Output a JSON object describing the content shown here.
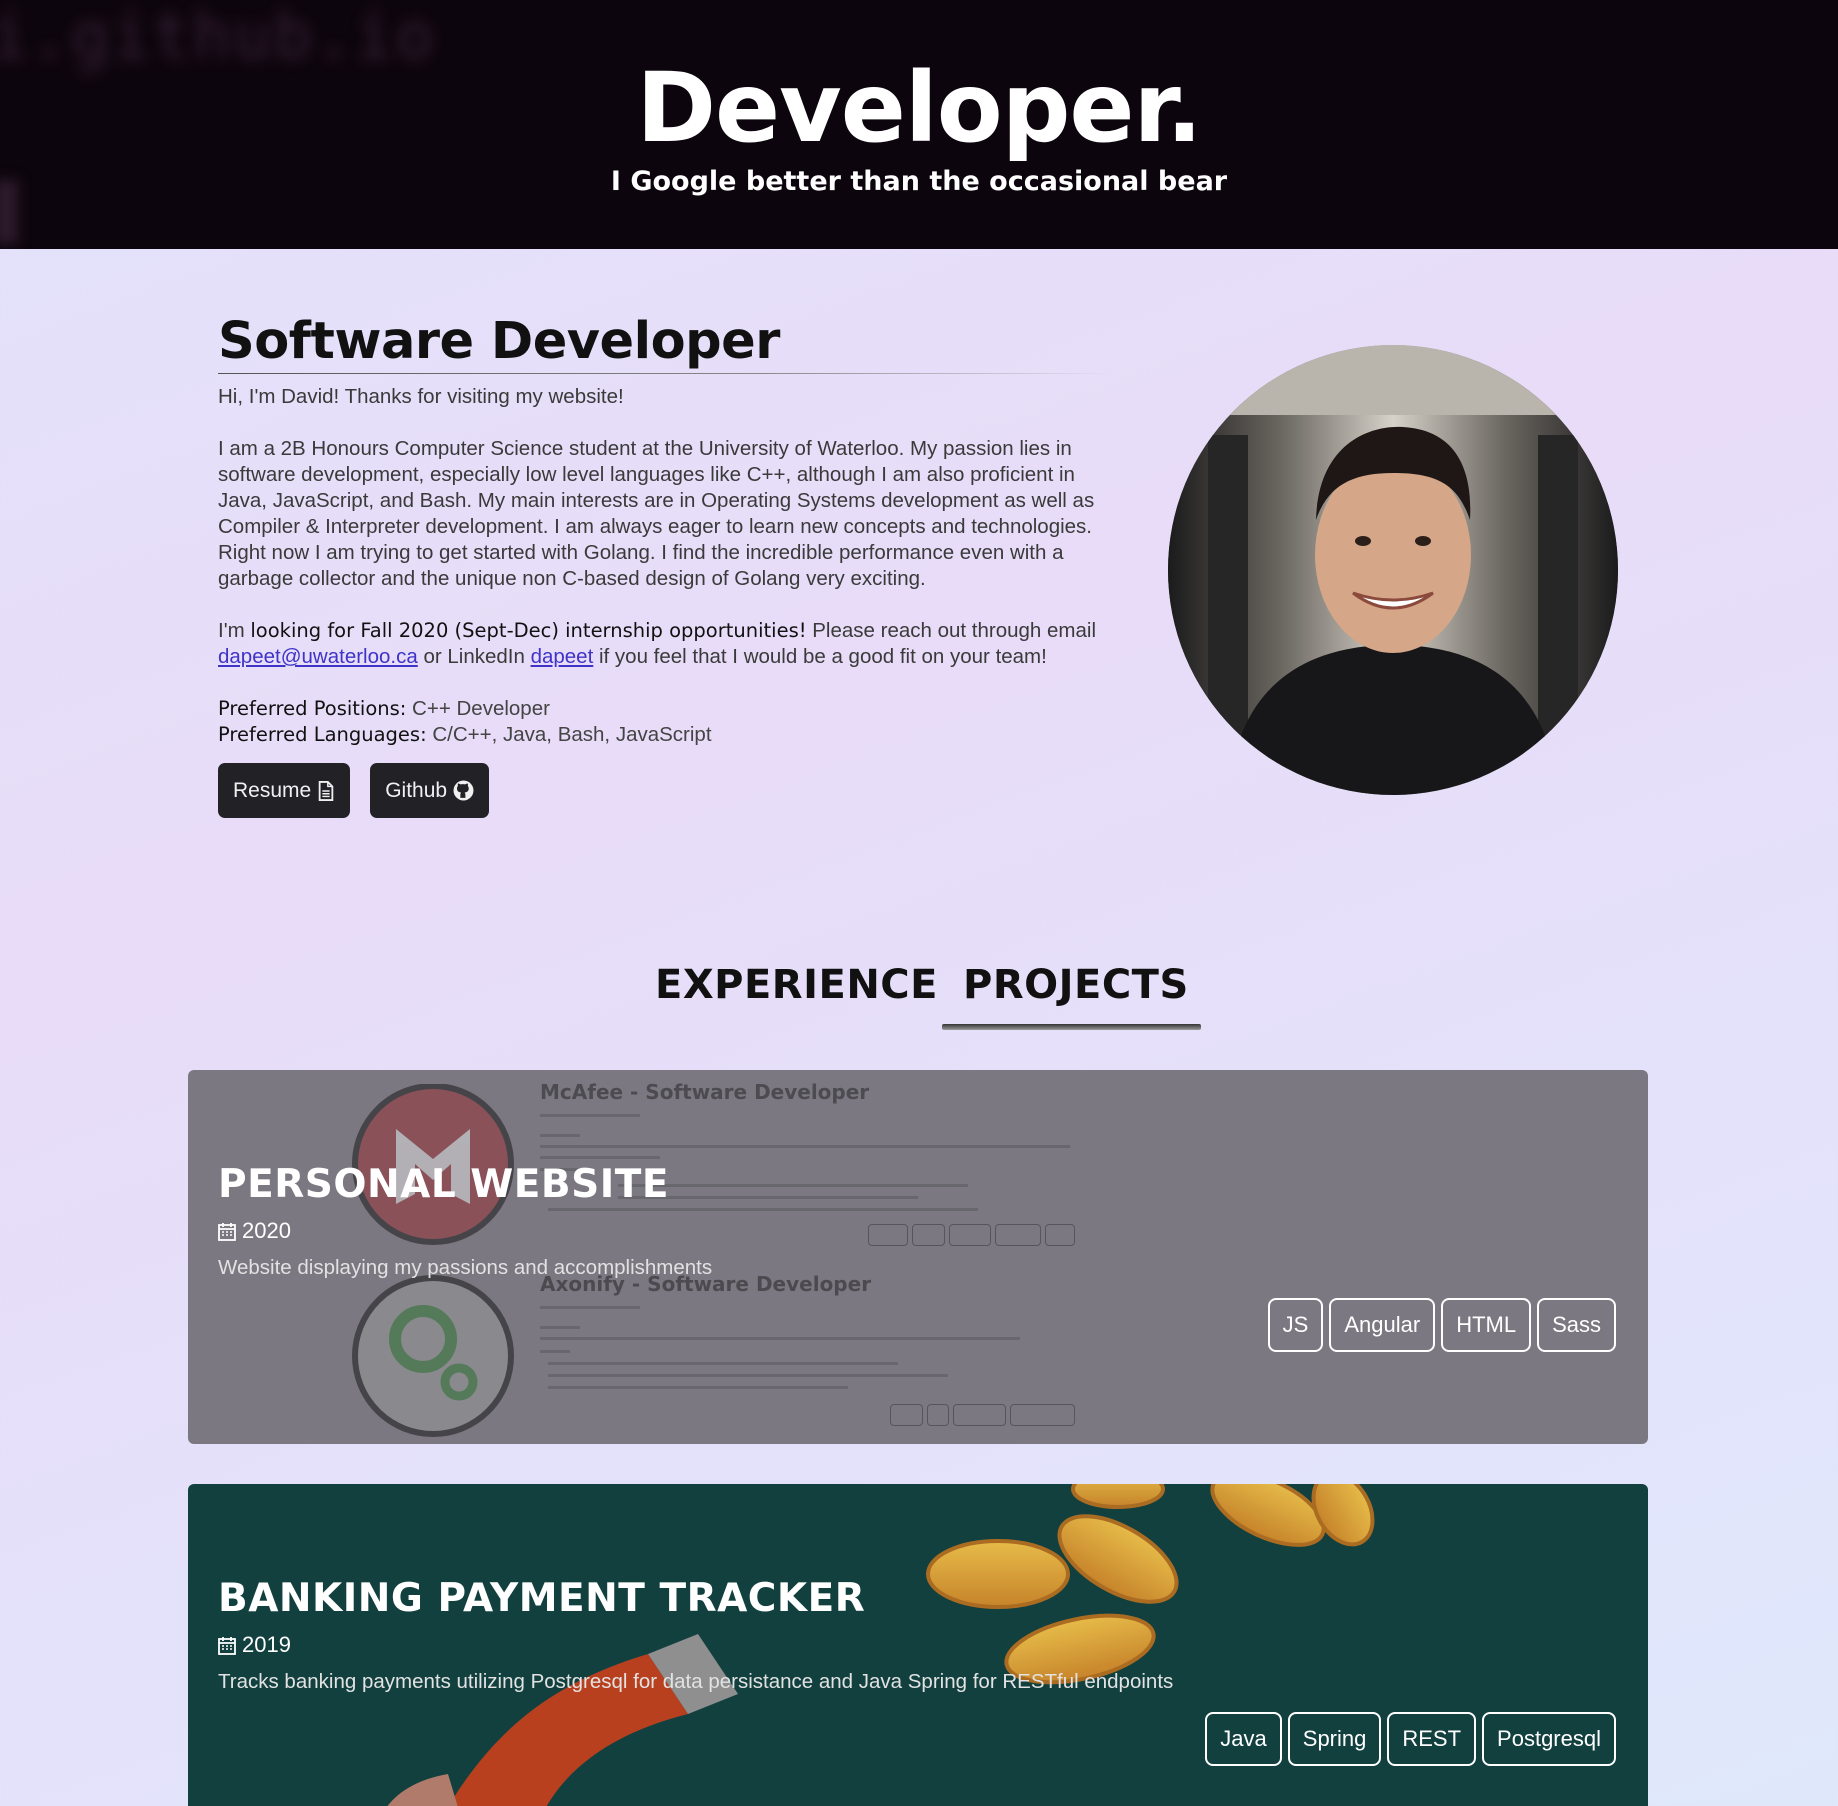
{
  "hero": {
    "background_text": "i.github.io",
    "title": "Developer.",
    "subtitle": "I Google better than the occasional bear"
  },
  "about": {
    "title": "Software Developer",
    "greeting": "Hi, I'm David! Thanks for visiting my website!",
    "bio": "I am a 2B Honours Computer Science student at the University of Waterloo. My passion lies in software development, especially low level languages like C++, although I am also proficient in Java, JavaScript, and Bash. My main interests are in Operating Systems development as well as Compiler & Interpreter development. I am always eager to learn new concepts and technologies. Right now I am trying to get started with Golang. I find the incredible performance even with a garbage collector and the unique non C-based design of Golang very exciting.",
    "looking_prefix": "I'm ",
    "looking_bold": "looking for Fall 2020 (Sept-Dec) internship opportunities!",
    "looking_mid": " Please reach out through email ",
    "email": "dapeet@uwaterloo.ca",
    "linkedin_prefix": " or LinkedIn ",
    "linkedin": "dapeet",
    "looking_suffix": " if you feel that I would be a good fit on your team!",
    "pref_positions_label": "Preferred Positions:",
    "pref_positions": " C++ Developer",
    "pref_languages_label": "Preferred Languages:",
    "pref_languages": " C/C++, Java, Bash, JavaScript",
    "resume_label": "Resume",
    "github_label": "Github"
  },
  "tabs": [
    {
      "label": "EXPERIENCE",
      "active": false
    },
    {
      "label": "PROJECTS",
      "active": true
    }
  ],
  "projects": [
    {
      "title": "PERSONAL WEBSITE",
      "year": "2020",
      "description": "Website displaying my passions and accomplishments",
      "tags": [
        "JS",
        "Angular",
        "HTML",
        "Sass"
      ],
      "background_color": "#7b7882",
      "background_resume": {
        "entry1": "McAfee - Software Developer",
        "entry2": "Axonify - Software Developer"
      }
    },
    {
      "title": "BANKING PAYMENT TRACKER",
      "year": "2019",
      "description": "Tracks banking payments utilizing Postgresql for data persistance and Java Spring for RESTful endpoints",
      "tags": [
        "Java",
        "Spring",
        "REST",
        "Postgresql"
      ],
      "background_color": "#11403f"
    }
  ],
  "colors": {
    "hero_bg": "#0d050d",
    "link": "#3f33c8",
    "button_bg": "#222226"
  }
}
